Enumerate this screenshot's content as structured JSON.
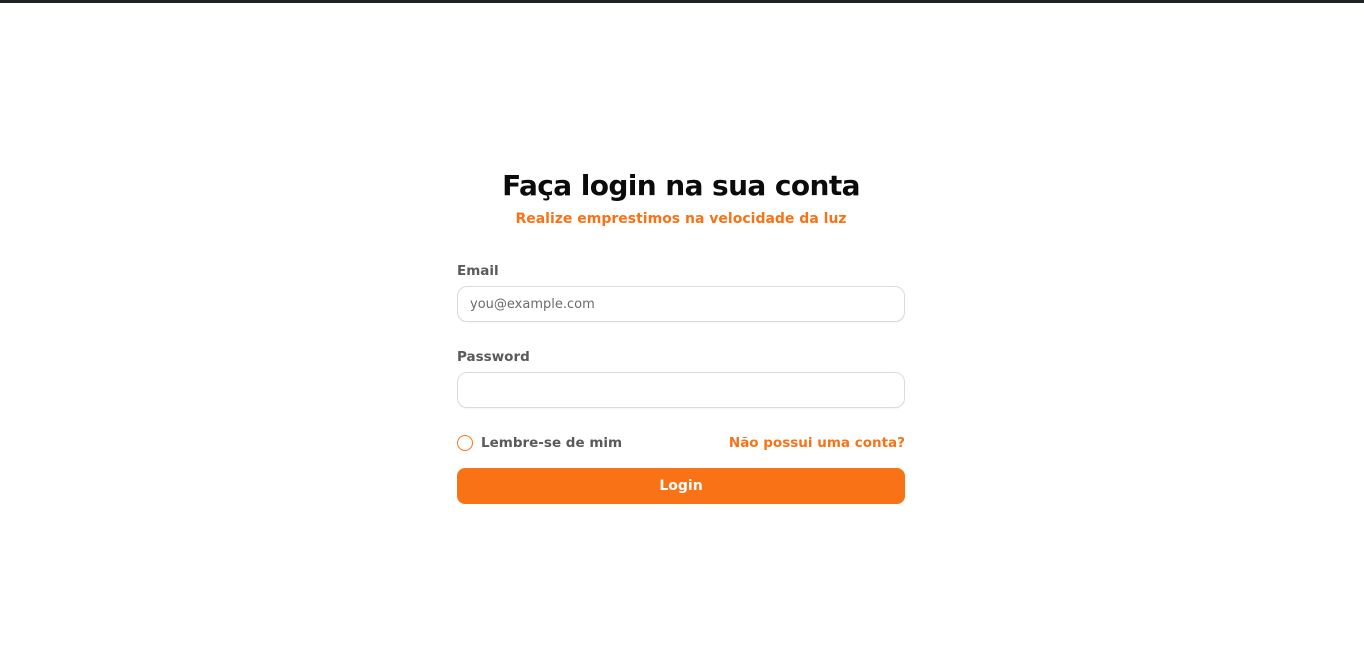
{
  "header": {
    "title": "Faça login na sua conta",
    "subtitle": "Realize emprestimos na velocidade da luz"
  },
  "form": {
    "email": {
      "label": "Email",
      "placeholder": "you@example.com",
      "value": ""
    },
    "password": {
      "label": "Password",
      "placeholder": "",
      "value": ""
    },
    "remember_label": "Lembre-se de mim",
    "remember_checked": false,
    "signup_link": "Não possui uma conta?",
    "submit_label": "Login"
  },
  "colors": {
    "accent": "#f97316",
    "top_bar": "#1f2326"
  }
}
